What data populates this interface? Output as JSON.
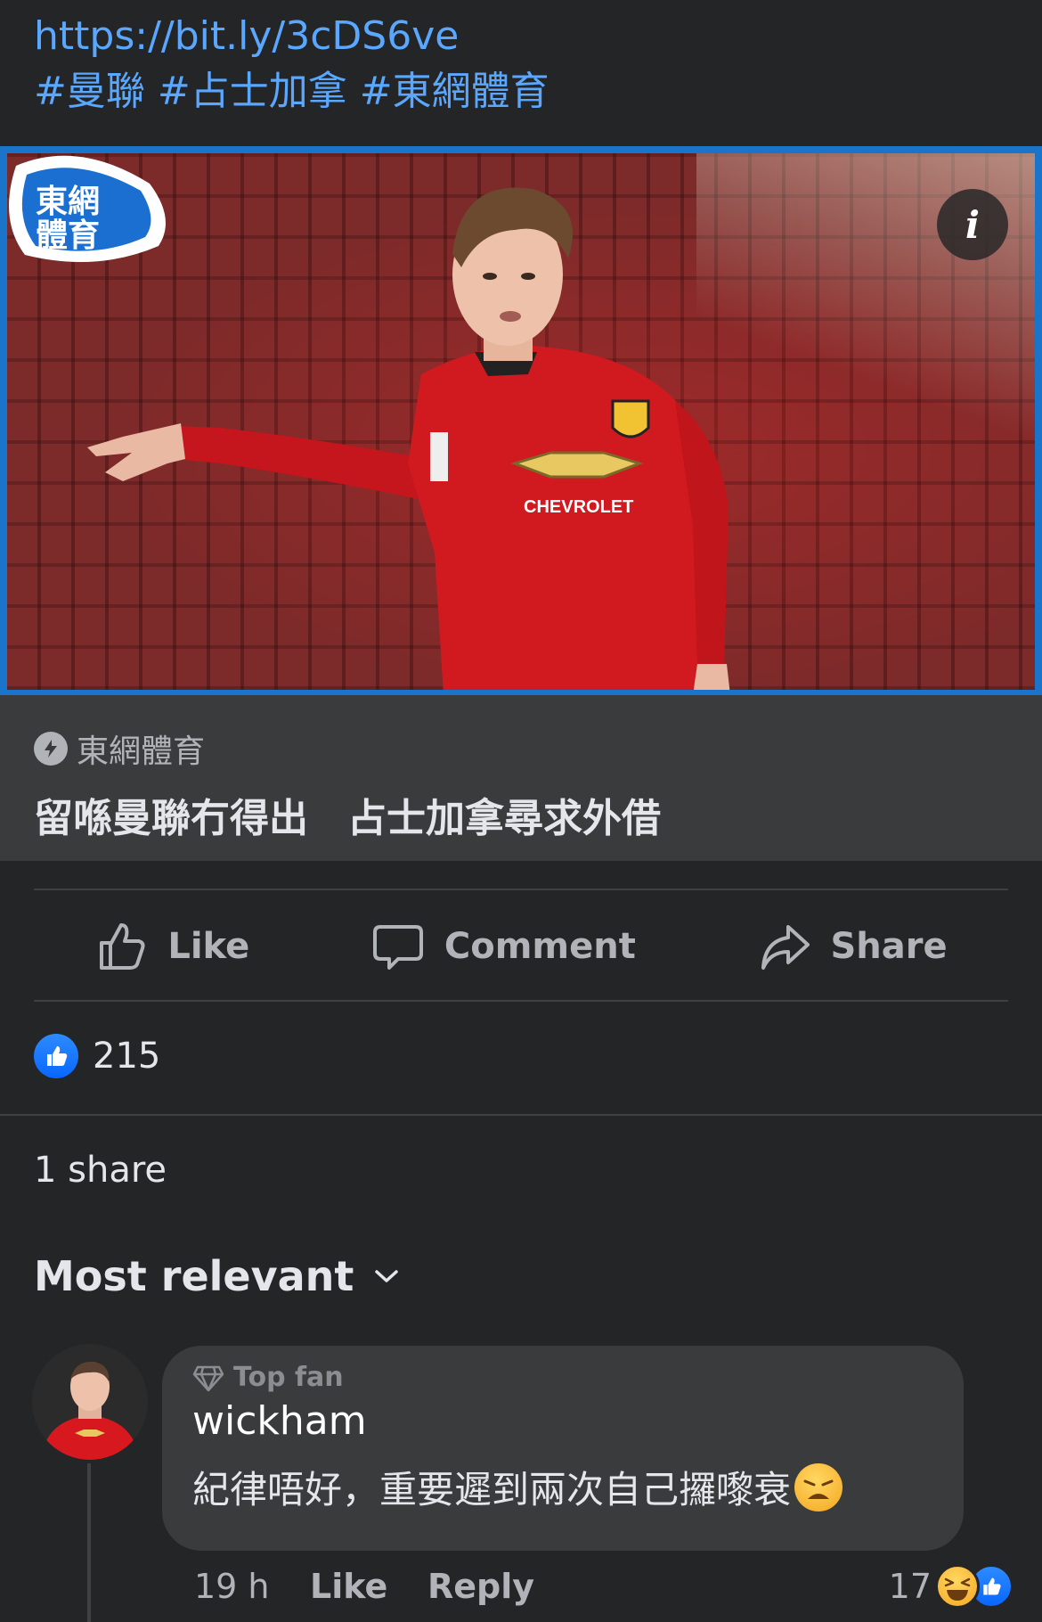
{
  "post": {
    "link": "https://bit.ly/3cDS6ve",
    "hashtags": "#曼聯 #占士加拿 #東網體育"
  },
  "link_card": {
    "image_logo_text": "東網體育",
    "info_icon": "info-icon",
    "source_name": "東網體育",
    "title": "留喺曼聯冇得出　占士加拿尋求外借"
  },
  "actions": {
    "like_label": "Like",
    "comment_label": "Comment",
    "share_label": "Share"
  },
  "reactions": {
    "like_count": "215"
  },
  "shares": {
    "label": "1 share"
  },
  "comments": {
    "sort_label": "Most relevant",
    "items": [
      {
        "badge": "Top fan",
        "author": "wickham",
        "text": "紀律唔好，重要遲到兩次自己攞嚟衰",
        "time": "19 h",
        "like_label": "Like",
        "reply_label": "Reply",
        "reaction_count": "17"
      }
    ]
  },
  "colors": {
    "background": "#242526",
    "link": "#5aa7ff",
    "card": "#3a3b3c",
    "like_blue": "#0866ff"
  }
}
